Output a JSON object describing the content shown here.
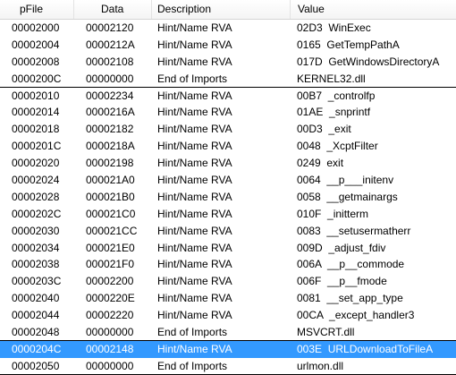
{
  "columns": {
    "pfile": "pFile",
    "data": "Data",
    "description": "Description",
    "value": "Value"
  },
  "rows": [
    {
      "pfile": "00002000",
      "data": "00002120",
      "description": "Hint/Name RVA",
      "value": "02D3  WinExec"
    },
    {
      "pfile": "00002004",
      "data": "0000212A",
      "description": "Hint/Name RVA",
      "value": "0165  GetTempPathA"
    },
    {
      "pfile": "00002008",
      "data": "00002108",
      "description": "Hint/Name RVA",
      "value": "017D  GetWindowsDirectoryA"
    },
    {
      "pfile": "0000200C",
      "data": "00000000",
      "description": "End of Imports",
      "value": "KERNEL32.dll"
    },
    {
      "pfile": "00002010",
      "data": "00002234",
      "description": "Hint/Name RVA",
      "value": "00B7  _controlfp"
    },
    {
      "pfile": "00002014",
      "data": "0000216A",
      "description": "Hint/Name RVA",
      "value": "01AE  _snprintf"
    },
    {
      "pfile": "00002018",
      "data": "00002182",
      "description": "Hint/Name RVA",
      "value": "00D3  _exit"
    },
    {
      "pfile": "0000201C",
      "data": "0000218A",
      "description": "Hint/Name RVA",
      "value": "0048  _XcptFilter"
    },
    {
      "pfile": "00002020",
      "data": "00002198",
      "description": "Hint/Name RVA",
      "value": "0249  exit"
    },
    {
      "pfile": "00002024",
      "data": "000021A0",
      "description": "Hint/Name RVA",
      "value": "0064  __p___initenv"
    },
    {
      "pfile": "00002028",
      "data": "000021B0",
      "description": "Hint/Name RVA",
      "value": "0058  __getmainargs"
    },
    {
      "pfile": "0000202C",
      "data": "000021C0",
      "description": "Hint/Name RVA",
      "value": "010F  _initterm"
    },
    {
      "pfile": "00002030",
      "data": "000021CC",
      "description": "Hint/Name RVA",
      "value": "0083  __setusermatherr"
    },
    {
      "pfile": "00002034",
      "data": "000021E0",
      "description": "Hint/Name RVA",
      "value": "009D  _adjust_fdiv"
    },
    {
      "pfile": "00002038",
      "data": "000021F0",
      "description": "Hint/Name RVA",
      "value": "006A  __p__commode"
    },
    {
      "pfile": "0000203C",
      "data": "00002200",
      "description": "Hint/Name RVA",
      "value": "006F  __p__fmode"
    },
    {
      "pfile": "00002040",
      "data": "0000220E",
      "description": "Hint/Name RVA",
      "value": "0081  __set_app_type"
    },
    {
      "pfile": "00002044",
      "data": "00002220",
      "description": "Hint/Name RVA",
      "value": "00CA  _except_handler3"
    },
    {
      "pfile": "00002048",
      "data": "00000000",
      "description": "End of Imports",
      "value": "MSVCRT.dll"
    },
    {
      "pfile": "0000204C",
      "data": "00002148",
      "description": "Hint/Name RVA",
      "value": "003E  URLDownloadToFileA"
    },
    {
      "pfile": "00002050",
      "data": "00000000",
      "description": "End of Imports",
      "value": "urlmon.dll"
    }
  ],
  "selected_row": "0000204C",
  "colors": {
    "selection": "#3399ff",
    "selection_text": "#ffffff",
    "separator": "#000000"
  }
}
